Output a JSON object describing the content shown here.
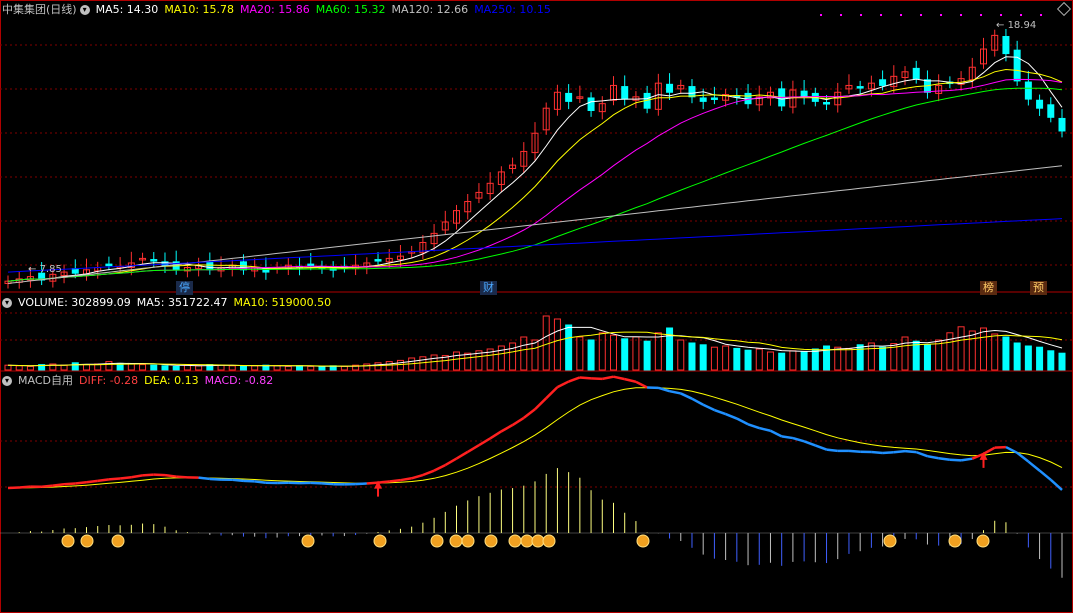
{
  "price_panel": {
    "stock_name": "中集集团(日线)",
    "ma": [
      {
        "label": "MA5: 14.30",
        "color": "#ffffff"
      },
      {
        "label": "MA10: 15.78",
        "color": "#ffff00"
      },
      {
        "label": "MA20: 15.86",
        "color": "#ff00ff"
      },
      {
        "label": "MA60: 15.32",
        "color": "#00ff00"
      },
      {
        "label": "MA120: 12.66",
        "color": "#c0c0c0"
      },
      {
        "label": "MA250: 10.15",
        "color": "#0000ff"
      }
    ],
    "high_label": "18.94",
    "low_label": "7.85",
    "event_tags": [
      {
        "text": "停",
        "color": "#4aa8ff",
        "bg": "#1a2a4a"
      },
      {
        "text": "财",
        "color": "#4aa8ff",
        "bg": "#1a2a4a"
      },
      {
        "text": "榜",
        "color": "#ffcc66",
        "bg": "#5a2a10"
      },
      {
        "text": "预",
        "color": "#ffcc66",
        "bg": "#5a2a10"
      }
    ]
  },
  "volume_panel": {
    "labels": [
      {
        "label": "VOLUME: 302899.09",
        "color": "#ffffff"
      },
      {
        "label": "MA5: 351722.47",
        "color": "#ffffff"
      },
      {
        "label": "MA10: 519000.50",
        "color": "#ffff00"
      }
    ]
  },
  "macd_panel": {
    "title": "MACD自用",
    "labels": [
      {
        "label": "DIFF: -0.28",
        "color": "#ff4040"
      },
      {
        "label": "DEA: 0.13",
        "color": "#ffff00"
      },
      {
        "label": "MACD: -0.82",
        "color": "#ff40ff"
      }
    ]
  },
  "colors": {
    "up": "#ff3030",
    "down": "#00ffff",
    "grid": "#800000",
    "ma5": "#ffffff",
    "ma10": "#ffff00",
    "ma20": "#ff00ff",
    "ma60": "#00ff00",
    "ma120": "#c0c0c0",
    "ma250": "#0000ff"
  },
  "price_close_series": [
    7.9,
    8.0,
    8.1,
    7.95,
    8.2,
    8.3,
    8.25,
    8.4,
    8.5,
    8.6,
    8.55,
    8.7,
    8.9,
    8.8,
    8.6,
    8.4,
    8.5,
    8.6,
    8.4,
    8.5,
    8.6,
    8.4,
    8.5,
    8.3,
    8.5,
    8.6,
    8.5,
    8.6,
    8.5,
    8.4,
    8.5,
    8.6,
    8.7,
    8.8,
    8.9,
    9.0,
    9.2,
    9.6,
    10.0,
    10.5,
    11.0,
    11.4,
    11.8,
    12.2,
    12.7,
    13.0,
    13.6,
    14.4,
    15.5,
    16.2,
    15.8,
    16.0,
    15.4,
    15.7,
    16.5,
    15.9,
    16.0,
    15.5,
    16.6,
    16.2,
    16.5,
    16.0,
    15.8,
    15.9,
    16.1,
    16.0,
    15.7,
    16.0,
    16.2,
    15.6,
    16.3,
    16.0,
    15.8,
    15.7,
    16.2,
    16.5,
    16.4,
    16.6,
    16.5,
    16.9,
    17.1,
    16.8,
    16.2,
    16.5,
    16.6,
    16.8,
    17.3,
    18.1,
    18.7,
    17.9,
    16.7,
    15.9,
    15.5,
    15.1,
    14.5
  ],
  "volume_series": [
    0.08,
    0.07,
    0.06,
    0.09,
    0.1,
    0.08,
    0.12,
    0.09,
    0.1,
    0.14,
    0.11,
    0.1,
    0.09,
    0.08,
    0.07,
    0.06,
    0.08,
    0.07,
    0.09,
    0.08,
    0.07,
    0.06,
    0.07,
    0.08,
    0.07,
    0.06,
    0.07,
    0.06,
    0.05,
    0.07,
    0.06,
    0.08,
    0.1,
    0.12,
    0.14,
    0.16,
    0.2,
    0.22,
    0.25,
    0.24,
    0.3,
    0.28,
    0.32,
    0.35,
    0.4,
    0.45,
    0.55,
    0.5,
    0.9,
    0.85,
    0.75,
    0.55,
    0.5,
    0.62,
    0.58,
    0.52,
    0.55,
    0.48,
    0.62,
    0.7,
    0.5,
    0.45,
    0.42,
    0.38,
    0.4,
    0.36,
    0.33,
    0.35,
    0.3,
    0.28,
    0.32,
    0.3,
    0.35,
    0.4,
    0.38,
    0.36,
    0.42,
    0.45,
    0.38,
    0.44,
    0.55,
    0.48,
    0.42,
    0.5,
    0.62,
    0.72,
    0.65,
    0.7,
    0.6,
    0.55,
    0.45,
    0.4,
    0.38,
    0.32,
    0.28
  ]
}
